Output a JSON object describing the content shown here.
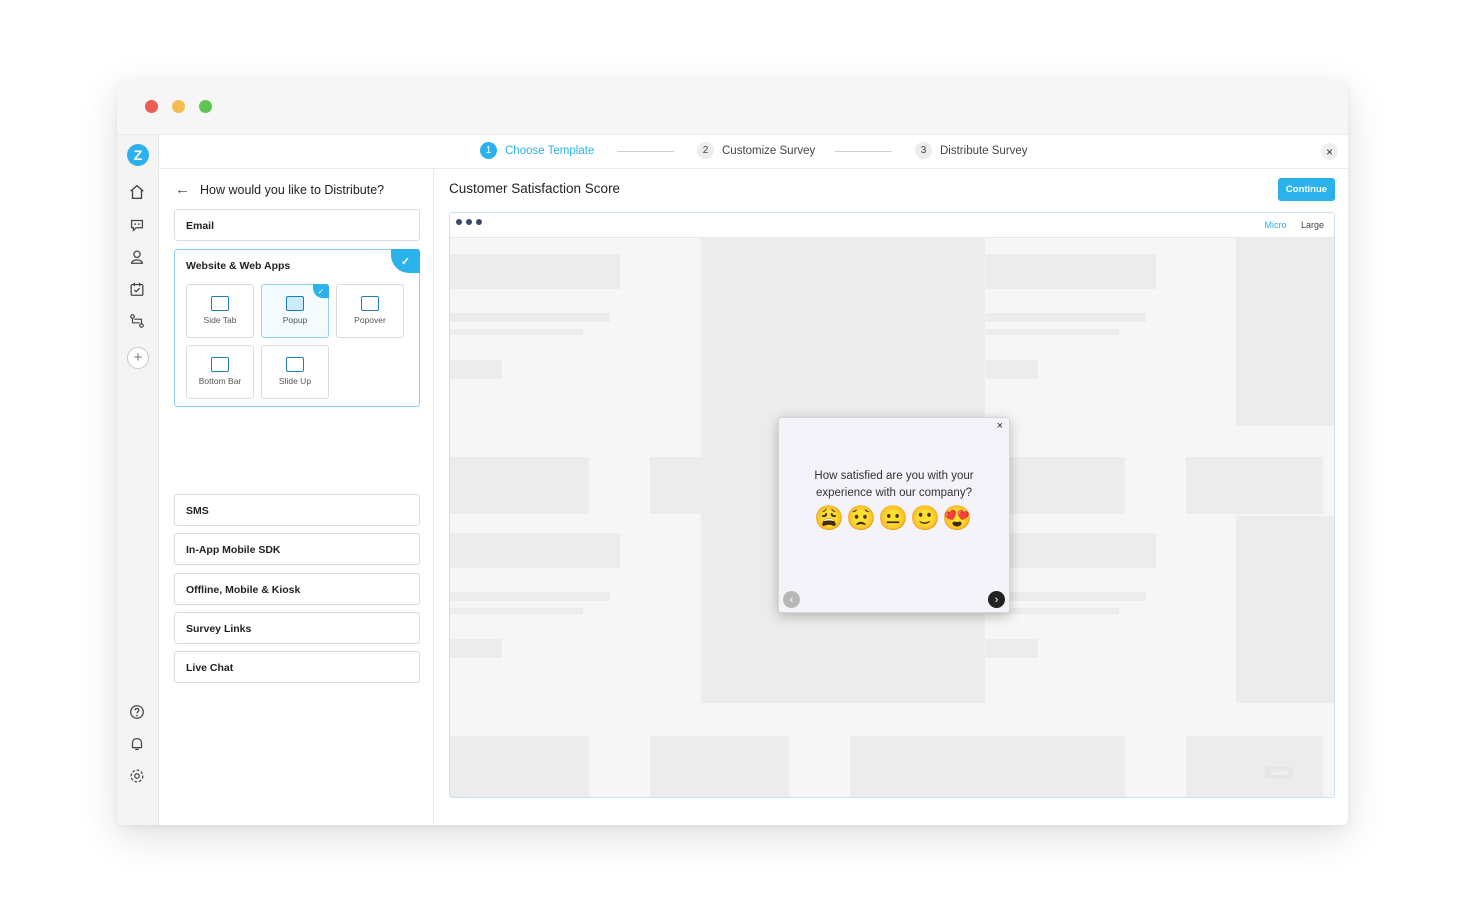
{
  "steps": [
    {
      "num": "1",
      "label": "Choose Template"
    },
    {
      "num": "2",
      "label": "Customize Survey"
    },
    {
      "num": "3",
      "label": "Distribute Survey"
    }
  ],
  "close_glyph": "×",
  "logo_letter": "Z",
  "sidepanel": {
    "heading": "How would you like to Distribute?",
    "options": {
      "email": "Email",
      "website": "Website & Web Apps",
      "sms": "SMS",
      "inapp": "In-App Mobile SDK",
      "offline": "Offline, Mobile & Kiosk",
      "links": "Survey Links",
      "livechat": "Live Chat"
    },
    "tiles": {
      "side_tab": "Side Tab",
      "popup": "Popup",
      "popover": "Popover",
      "bottom_bar": "Bottom Bar",
      "slide_up": "Slide Up"
    },
    "selected_tile": "Popup"
  },
  "main": {
    "title": "Customer Satisfaction Score",
    "continue": "Continue",
    "size_micro": "Micro",
    "size_large": "Large",
    "ghost_save": "Save"
  },
  "popup": {
    "question": "How satisfied are you with your experience with our company?",
    "emojis": [
      "😩",
      "😟",
      "😐",
      "🙂",
      "😍"
    ]
  },
  "colors": {
    "accent": "#2bb2ec",
    "dot_red": "#ed5b55",
    "dot_yellow": "#f5bd4f",
    "dot_green": "#5fc553"
  },
  "rail_icons": [
    "home-icon",
    "chat-bot-icon",
    "user-icon",
    "calendar-check-icon",
    "workflow-icon",
    "help-icon",
    "bell-icon",
    "settings-icon"
  ]
}
